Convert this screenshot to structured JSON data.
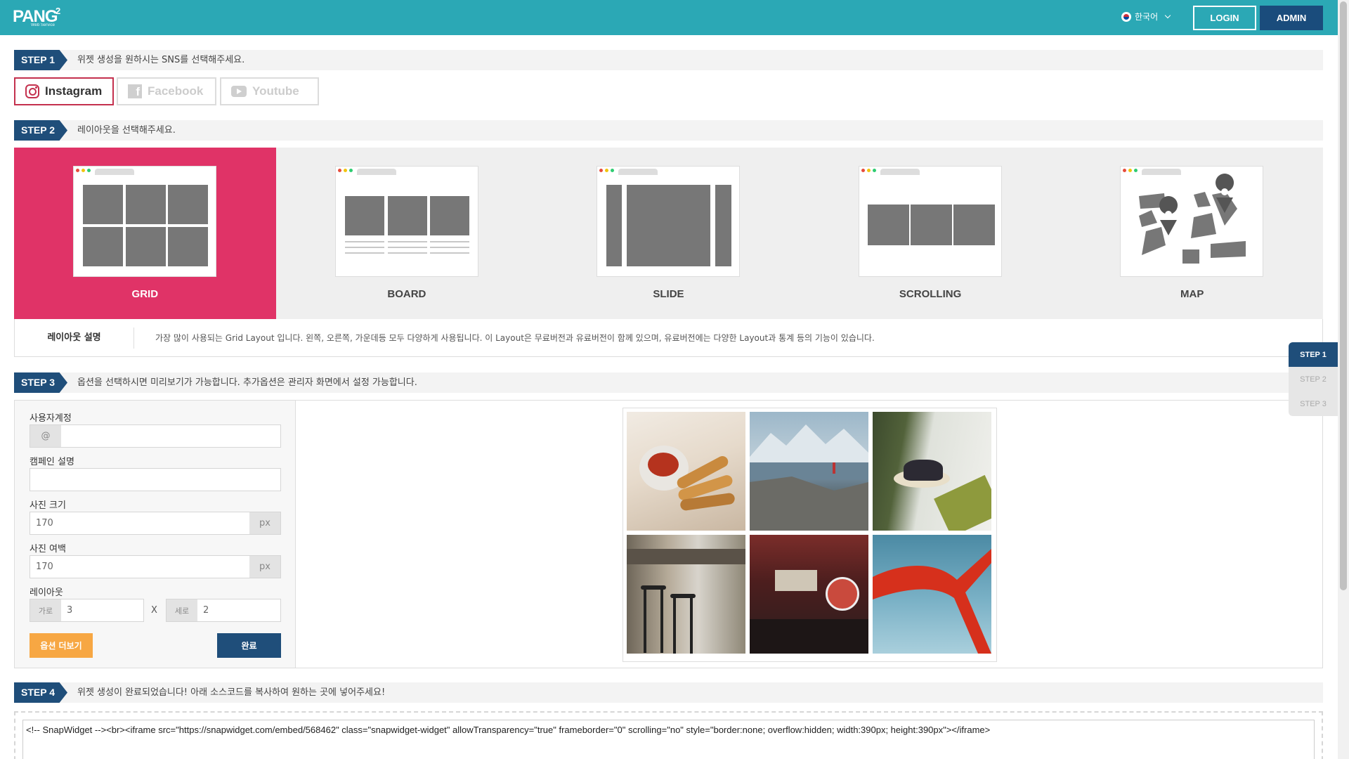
{
  "header": {
    "logo_text": "PANG",
    "logo_sup": "2",
    "logo_tagline": "Web Service",
    "language": "한국어",
    "login_label": "LOGIN",
    "admin_label": "ADMIN",
    "color": "#2ba8b5"
  },
  "step1": {
    "tag": "STEP 1",
    "text": "위젯 생성을 원하시는 SNS를 선택해주세요.",
    "sns": [
      {
        "label": "Instagram",
        "icon": "instagram-icon",
        "selected": true
      },
      {
        "label": "Facebook",
        "icon": "facebook-icon",
        "selected": false
      },
      {
        "label": "Youtube",
        "icon": "youtube-icon",
        "selected": false
      }
    ]
  },
  "step2": {
    "tag": "STEP 2",
    "text": "레이아웃을 선택해주세요.",
    "layouts": [
      {
        "label": "GRID",
        "selected": true
      },
      {
        "label": "BOARD",
        "selected": false
      },
      {
        "label": "SLIDE",
        "selected": false
      },
      {
        "label": "SCROLLING",
        "selected": false
      },
      {
        "label": "MAP",
        "selected": false
      }
    ],
    "selected_color": "#e03367",
    "desc_title": "레이아웃 설명",
    "desc_text": "가장 많이 사용되는 Grid Layout 입니다. 왼쪽, 오른쪽, 가운데등 모두 다양하게 사용됩니다. 이 Layout은 무료버전과 유료버전이 함께 있으며, 유료버전에는 다양한 Layout과 통계 등의 기능이 있습니다."
  },
  "step3": {
    "tag": "STEP 3",
    "text": "옵션을 선택하시면 미리보기가 가능합니다. 추가옵션은 관리자 화면에서 설정 가능합니다.",
    "user_account_label": "사용자계정",
    "user_account_prefix": "@",
    "user_account_value": "",
    "campaign_label": "캠페인 설명",
    "campaign_value": "",
    "photo_size_label": "사진 크기",
    "photo_size_value": "170",
    "photo_size_unit": "px",
    "photo_margin_label": "사진 여백",
    "photo_margin_value": "170",
    "photo_margin_unit": "px",
    "layout_label": "레이아웃",
    "cols_label": "가로",
    "cols_value": "3",
    "times": "X",
    "rows_label": "세로",
    "rows_value": "2",
    "more_options_label": "옵션 더보기",
    "done_label": "완료",
    "preview_photos": [
      "chicken-strips-photo",
      "mountain-lake-photo",
      "cake-plate-photo",
      "bar-stools-photo",
      "restaurant-interior-photo",
      "red-sculpture-photo"
    ]
  },
  "step4": {
    "tag": "STEP 4",
    "text": "위젯 생성이 완료되었습니다! 아래 소스코드를 복사하여 원하는 곳에 넣어주세요!",
    "code": "<!-- SnapWidget --><br><iframe src=\"https://snapwidget.com/embed/568462\" class=\"snapwidget-widget\" allowTransparency=\"true\" frameborder=\"0\" scrolling=\"no\" style=\"border:none; overflow:hidden; width:390px; height:390px\"></iframe>"
  },
  "floating_nav": [
    "STEP 1",
    "STEP 2",
    "STEP 3"
  ]
}
